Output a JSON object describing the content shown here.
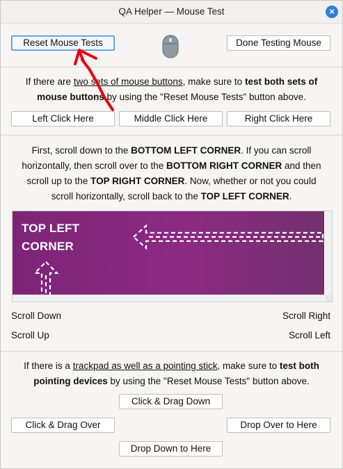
{
  "window": {
    "title": "QA Helper — Mouse Test",
    "close_glyph": "×"
  },
  "top": {
    "reset_label": "Reset Mouse Tests",
    "done_label": "Done Testing Mouse",
    "mouse_icon": "mouse-icon"
  },
  "buttons_section": {
    "p1": "If there are ",
    "p1_u": "two sets of mouse buttons",
    "p2": ", make sure to ",
    "p2_b": "test both sets of mouse buttons",
    "p3": " by using the \"Reset Mouse Tests\" button above.",
    "left": "Left Click Here",
    "middle": "Middle Click Here",
    "right": "Right Click Here"
  },
  "scroll_section": {
    "s1": "First, scroll down to the ",
    "s1_b": "BOTTOM LEFT CORNER",
    "s2": ". If you can scroll horizontally, then scroll over to the ",
    "s2_b": "BOTTOM RIGHT CORNER",
    "s3": " and then scroll up to the ",
    "s3_b": "TOP RIGHT CORNER",
    "s4": ". Now, whether or not you could scroll horizontally, scroll back to the ",
    "s4_b": "TOP LEFT CORNER",
    "s5": ".",
    "canvas_line1": "TOP LEFT",
    "canvas_line2": "CORNER",
    "canvas_color": "#7d2478",
    "scroll_down": "Scroll Down",
    "scroll_right": "Scroll Right",
    "scroll_up": "Scroll Up",
    "scroll_left": "Scroll Left"
  },
  "drag_section": {
    "d1": "If there is a ",
    "d1_u": "trackpad as well as a pointing stick",
    "d2": ", make sure to ",
    "d2_b": "test both pointing devices",
    "d3": " by using the \"Reset Mouse Tests\" button above.",
    "drag_down": "Click & Drag Down",
    "drag_over": "Click & Drag Over",
    "drop_over": "Drop Over to Here",
    "drop_down": "Drop Down to Here"
  },
  "colors": {
    "accent": "#2f7fd6",
    "annotation": "#e8000f"
  }
}
